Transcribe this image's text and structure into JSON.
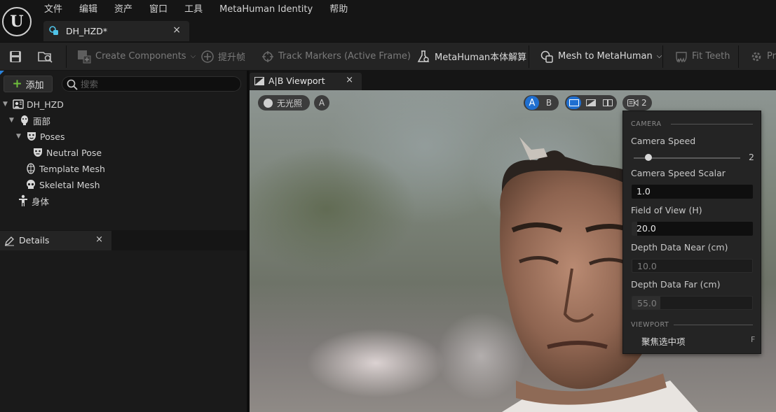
{
  "app": {
    "logo_letter": "U",
    "menu": [
      "文件",
      "编辑",
      "资产",
      "窗口",
      "工具",
      "MetaHuman Identity",
      "帮助"
    ],
    "document_tab": {
      "label": "DH_HZD*",
      "close": "×"
    }
  },
  "toolbar": {
    "create_components": "Create Components",
    "promote_frame": "提升帧",
    "track_markers": "Track Markers (Active Frame)",
    "metahuman_solve": "MetaHuman本体解算",
    "mesh_to_metahuman": "Mesh to MetaHuman",
    "fit_teeth": "Fit Teeth",
    "prepare": "Pr"
  },
  "outliner": {
    "add_button": "添加",
    "search_placeholder": "搜索",
    "tree": [
      {
        "label": "DH_HZD",
        "icon": "identity-icon"
      },
      {
        "label": "面部",
        "icon": "face-icon"
      },
      {
        "label": "Poses",
        "icon": "mask-icon"
      },
      {
        "label": "Neutral Pose",
        "icon": "mask-icon"
      },
      {
        "label": "Template Mesh",
        "icon": "template-mesh-icon"
      },
      {
        "label": "Skeletal Mesh",
        "icon": "skull-icon"
      },
      {
        "label": "身体",
        "icon": "body-icon"
      }
    ]
  },
  "details": {
    "title": "Details",
    "close": "×"
  },
  "viewport": {
    "tab_label": "A|B Viewport",
    "close": "×",
    "lighting_mode": "无光照",
    "a_button": "A",
    "ab_a": "A",
    "ab_b": "B",
    "camera_speed_badge": "2",
    "colors": {
      "accent": "#1f6fd1"
    }
  },
  "camera_popup": {
    "section_camera": "CAMERA",
    "camera_speed_label": "Camera Speed",
    "camera_speed_value": "2",
    "camera_speed_fraction": 0.14,
    "camera_speed_scalar_label": "Camera Speed Scalar",
    "camera_speed_scalar_value": "1.0",
    "fov_label": "Field of View (H)",
    "fov_value": "20.0",
    "depth_near_label": "Depth Data Near (cm)",
    "depth_near_value": "10.0",
    "depth_far_label": "Depth Data Far (cm)",
    "depth_far_value": "55.0",
    "section_viewport": "VIEWPORT",
    "focus_selected": "聚焦选中项",
    "focus_shortcut": "F"
  }
}
